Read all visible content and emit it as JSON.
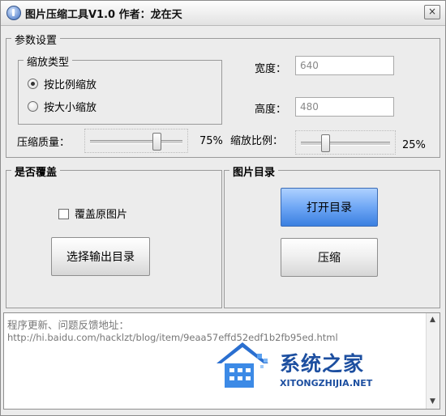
{
  "window": {
    "title": "图片压缩工具V1.0   作者：龙在天",
    "close_label": "×"
  },
  "params": {
    "legend": "参数设置",
    "scale_type": {
      "legend": "缩放类型",
      "options": [
        "按比例缩放",
        "按大小缩放"
      ],
      "selected_index": 0
    },
    "width": {
      "label": "宽度：",
      "value": "640"
    },
    "height": {
      "label": "高度：",
      "value": "480"
    },
    "quality": {
      "label": "压缩质量：",
      "value_text": "75%",
      "value": 75
    },
    "ratio": {
      "label": "缩放比例：",
      "value_text": "25%",
      "value": 25
    }
  },
  "overwrite": {
    "legend": "是否覆盖",
    "checkbox_label": "覆盖原图片",
    "checked": false,
    "select_dir_button": "选择输出目录"
  },
  "image_dir": {
    "legend": "图片目录",
    "open_button": "打开目录",
    "compress_button": "压缩"
  },
  "log": {
    "line1": "程序更新、问题反馈地址：",
    "line2": "http://hi.baidu.com/hacklzt/blog/item/9eaa57effd52edf1b2fb95ed.html"
  },
  "watermark": {
    "text": "系统之家",
    "sub": "XITONGZHIJIA.NET"
  },
  "colors": {
    "accent_blue": "#3a7fe0",
    "watermark_blue": "#1d4fa0"
  }
}
